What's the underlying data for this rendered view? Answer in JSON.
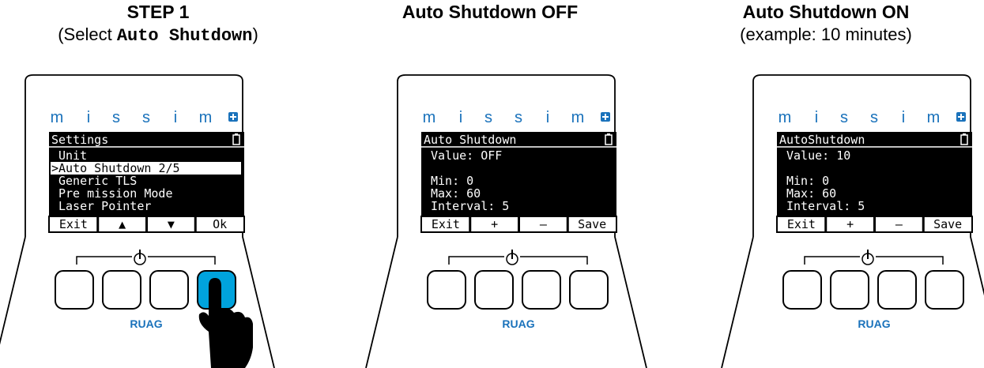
{
  "panels": [
    {
      "title": "STEP 1",
      "subtitle_prefix": "(Select ",
      "subtitle_code": "Auto Shutdown",
      "subtitle_suffix": ")",
      "brand": "m i s s i m",
      "logo": "RUAG",
      "screen": {
        "header": "Settings",
        "lines": [
          "Unit",
          ">Auto Shutdown   2/5",
          "Generic TLS",
          "Pre mission Mode",
          "Laser Pointer"
        ],
        "softkeys": [
          "Exit",
          "▲",
          "▼",
          "Ok"
        ]
      },
      "pressed_button": "button 4",
      "pressed_color": "#00a3dd"
    },
    {
      "title": "Auto Shutdown OFF",
      "brand": "m i s s i m",
      "logo": "RUAG",
      "screen": {
        "header": "Auto Shutdown",
        "lines": [
          "Value: OFF",
          "",
          "     Min: 0",
          "     Max: 60",
          "Interval: 5"
        ],
        "softkeys": [
          "Exit",
          "+",
          "–",
          "Save"
        ]
      }
    },
    {
      "title": "Auto Shutdown ON",
      "subtitle": "(example: 10 minutes)",
      "brand": "m i s s i m",
      "logo": "RUAG",
      "screen": {
        "header": "AutoShutdown",
        "lines": [
          "  Value:      10",
          "",
          "    Min:       0",
          "    Max:      60",
          "Interval:       5"
        ],
        "softkeys": [
          "Exit",
          "+",
          "–",
          "Save"
        ]
      }
    }
  ],
  "icons": [
    "battery-icon",
    "power-icon",
    "hand-pointer-icon",
    "plus-square-icon"
  ]
}
